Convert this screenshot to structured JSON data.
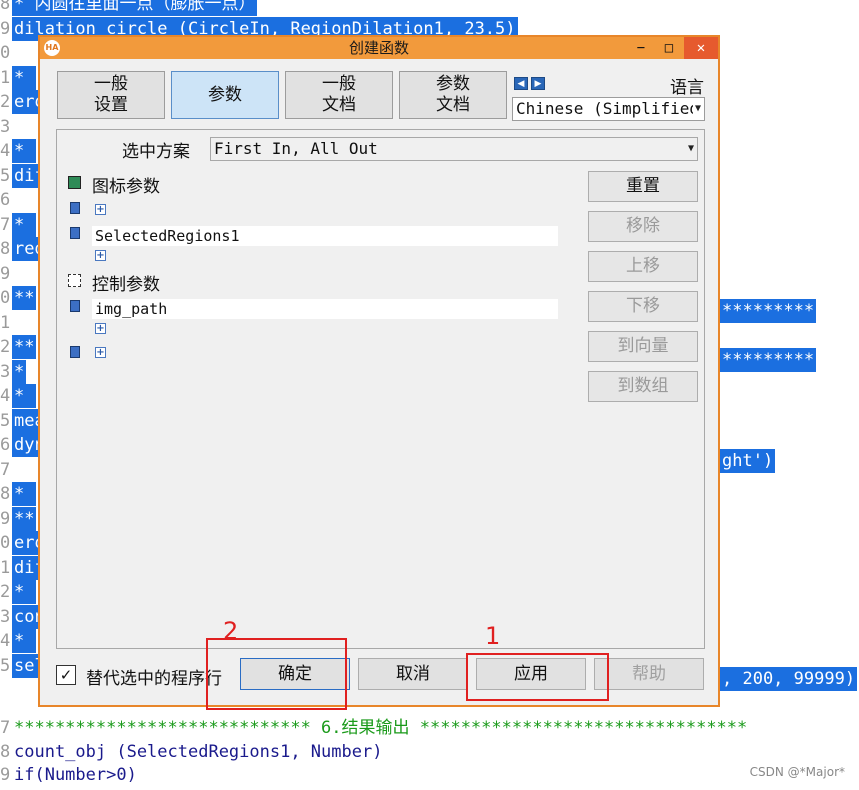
{
  "editor": {
    "line_numbers": [
      "8",
      "9",
      "0",
      "1",
      "2",
      "3",
      "4",
      "5",
      "6",
      "7",
      "8",
      "9",
      "0",
      "1",
      "2",
      "3",
      "4",
      "5",
      "6",
      "7",
      "8",
      "9",
      "0",
      "1",
      "2",
      "3",
      "4",
      "5",
      "6",
      "7",
      "8",
      "9"
    ],
    "lines": [
      {
        "text": "* 内圆往里面一点（膨胀一点）",
        "selected": true
      },
      {
        "text": "dilation_circle (CircleIn, RegionDilation1, 23.5)",
        "selected": true
      },
      {
        "text": "",
        "selected": false
      },
      {
        "text": "* ",
        "selected": true
      },
      {
        "text": "ero",
        "selected": true
      },
      {
        "text": "",
        "selected": false
      },
      {
        "text": "* ",
        "selected": true
      },
      {
        "text": "dif",
        "selected": true
      },
      {
        "text": "",
        "selected": false
      },
      {
        "text": "* ",
        "selected": true
      },
      {
        "text": "red",
        "selected": true
      },
      {
        "text": "",
        "selected": false
      },
      {
        "text": "**",
        "selected": true
      },
      {
        "text": "",
        "selected": false
      },
      {
        "text": "**",
        "selected": true
      },
      {
        "text": "*",
        "selected": true
      },
      {
        "text": "* ",
        "selected": true
      },
      {
        "text": "mea",
        "selected": true
      },
      {
        "text": "dyn",
        "selected": true
      },
      {
        "text": "",
        "selected": false
      },
      {
        "text": "* ",
        "selected": true
      },
      {
        "text": "**",
        "selected": true
      },
      {
        "text": "ero",
        "selected": true
      },
      {
        "text": "dif",
        "selected": true
      },
      {
        "text": "* ",
        "selected": true
      },
      {
        "text": "con",
        "selected": true
      },
      {
        "text": "* ",
        "selected": true
      },
      {
        "text": "sel",
        "selected": true
      }
    ],
    "right_fragments": {
      "stars_1": "*********",
      "stars_2": "*********",
      "ght": "ght')",
      "tail": ", 200, 99999)"
    },
    "bottom_lines": {
      "result_header": "***************************** 6.结果输出 ********************************",
      "count_obj": "count_obj (SelectedRegions1, Number)",
      "if_line": "if(Number>0)"
    }
  },
  "dialog": {
    "title": "创建函数",
    "logo": "HA",
    "window_buttons": {
      "minimize": "−",
      "maximize": "□",
      "close": "✕"
    },
    "tabs": [
      {
        "label": "一般\n设置",
        "active": false
      },
      {
        "label": "参数",
        "active": true
      },
      {
        "label": "一般\n文档",
        "active": false
      },
      {
        "label": "参数\n文档",
        "active": false
      }
    ],
    "language": {
      "label": "语言",
      "value": "Chinese (Simplified"
    },
    "scheme": {
      "label": "选中方案",
      "value": "First In, All Out"
    },
    "icon_params": {
      "heading": "图标参数",
      "fields": [
        "",
        "SelectedRegions1"
      ]
    },
    "control_params": {
      "heading": "控制参数",
      "fields": [
        "img_path",
        ""
      ]
    },
    "side_buttons": [
      {
        "label": "重置",
        "enabled": true
      },
      {
        "label": "移除",
        "enabled": false
      },
      {
        "label": "上移",
        "enabled": false
      },
      {
        "label": "下移",
        "enabled": false
      },
      {
        "label": "到向量",
        "enabled": false
      },
      {
        "label": "到数组",
        "enabled": false
      }
    ],
    "replace_checkbox": {
      "label": "替代选中的程序行",
      "checked": true,
      "mark": "✓"
    },
    "buttons": {
      "ok": "确定",
      "cancel": "取消",
      "apply": "应用",
      "help": "帮助"
    }
  },
  "annotations": {
    "marker_1": "1",
    "marker_2": "2",
    "color": "#e02020"
  },
  "watermark": "CSDN @*Major*"
}
